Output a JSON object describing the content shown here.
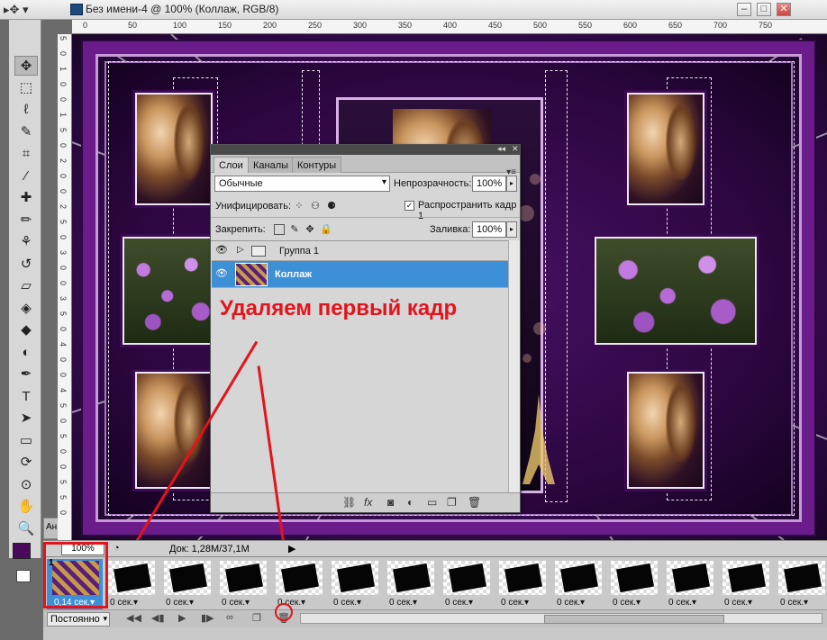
{
  "window": {
    "title": "Без имени-4 @ 100% (Коллаж, RGB/8)",
    "minimize": "–",
    "maximize": "□",
    "close": "✕"
  },
  "ruler": {
    "top_ticks": [
      "0",
      "50",
      "100",
      "150",
      "200",
      "250",
      "300",
      "350",
      "400",
      "450",
      "500",
      "550",
      "600",
      "650",
      "700",
      "750"
    ],
    "left_ticks": [
      "5",
      "0",
      "1",
      "0",
      "0",
      "1",
      "5",
      "0",
      "2",
      "0",
      "0",
      "2",
      "5",
      "0",
      "3",
      "0",
      "0",
      "3",
      "5",
      "0",
      "4",
      "0",
      "0",
      "4",
      "5",
      "0",
      "5",
      "0",
      "0",
      "5",
      "5",
      "0"
    ]
  },
  "tools": [
    {
      "name": "move-tool-icon",
      "glyph": "✥"
    },
    {
      "name": "marquee-tool-icon",
      "glyph": "⬚"
    },
    {
      "name": "lasso-tool-icon",
      "glyph": "ℓ"
    },
    {
      "name": "quick-select-tool-icon",
      "glyph": "✎"
    },
    {
      "name": "crop-tool-icon",
      "glyph": "⌗"
    },
    {
      "name": "eyedropper-tool-icon",
      "glyph": "⁄"
    },
    {
      "name": "healing-brush-tool-icon",
      "glyph": "✚"
    },
    {
      "name": "brush-tool-icon",
      "glyph": "✏"
    },
    {
      "name": "stamp-tool-icon",
      "glyph": "⚘"
    },
    {
      "name": "history-brush-tool-icon",
      "glyph": "↺"
    },
    {
      "name": "eraser-tool-icon",
      "glyph": "▱"
    },
    {
      "name": "paint-bucket-tool-icon",
      "glyph": "◈"
    },
    {
      "name": "blur-tool-icon",
      "glyph": "◆"
    },
    {
      "name": "dodge-tool-icon",
      "glyph": "◐"
    },
    {
      "name": "pen-tool-icon",
      "glyph": "✒"
    },
    {
      "name": "type-tool-icon",
      "glyph": "T"
    },
    {
      "name": "path-select-tool-icon",
      "glyph": "➤"
    },
    {
      "name": "rectangle-tool-icon",
      "glyph": "▭"
    },
    {
      "name": "3d-rotate-tool-icon",
      "glyph": "⟳"
    },
    {
      "name": "3d-orbit-tool-icon",
      "glyph": "⊙"
    },
    {
      "name": "hand-tool-icon",
      "glyph": "✋"
    },
    {
      "name": "zoom-tool-icon",
      "glyph": "🔍"
    }
  ],
  "layers_panel": {
    "tabs": [
      "Слои",
      "Каналы",
      "Контуры"
    ],
    "blend_mode": "Обычные",
    "opacity_label": "Непрозрачность:",
    "opacity_value": "100%",
    "unify_label": "Унифицировать:",
    "propagate_label": "Распространить кадр 1",
    "propagate_checked": "✓",
    "lock_label": "Закрепить:",
    "fill_label": "Заливка:",
    "fill_value": "100%",
    "layers": [
      {
        "name": "Группа 1",
        "type": "group"
      },
      {
        "name": "Коллаж",
        "type": "layer",
        "selected": true
      }
    ]
  },
  "annotation": {
    "text": "Удаляем первый кадр",
    "color": "#e3141b"
  },
  "status_bar": {
    "zoom": "100%",
    "doc_info": "Док: 1,28M/37,1M"
  },
  "animation": {
    "frames": [
      {
        "num": "1",
        "delay": "0,14 сек."
      },
      {
        "num": "",
        "delay": "0 сек."
      },
      {
        "num": "",
        "delay": "0 сек."
      },
      {
        "num": "",
        "delay": "0 сек."
      },
      {
        "num": "",
        "delay": "0 сек."
      },
      {
        "num": "",
        "delay": "0 сек."
      },
      {
        "num": "",
        "delay": "0 сек."
      },
      {
        "num": "",
        "delay": "0 сек."
      },
      {
        "num": "",
        "delay": "0 сек."
      },
      {
        "num": "",
        "delay": "0 сек."
      },
      {
        "num": "",
        "delay": "0 сек."
      },
      {
        "num": "",
        "delay": "0 сек."
      },
      {
        "num": "",
        "delay": "0 сек."
      },
      {
        "num": "",
        "delay": "0 сек."
      }
    ],
    "loop": "Постоянно",
    "panel_tab": "Ан"
  },
  "colors": {
    "accent_selection": "#3d8fd6",
    "foreground": "#4a0a5c",
    "annotation": "#e3141b"
  }
}
